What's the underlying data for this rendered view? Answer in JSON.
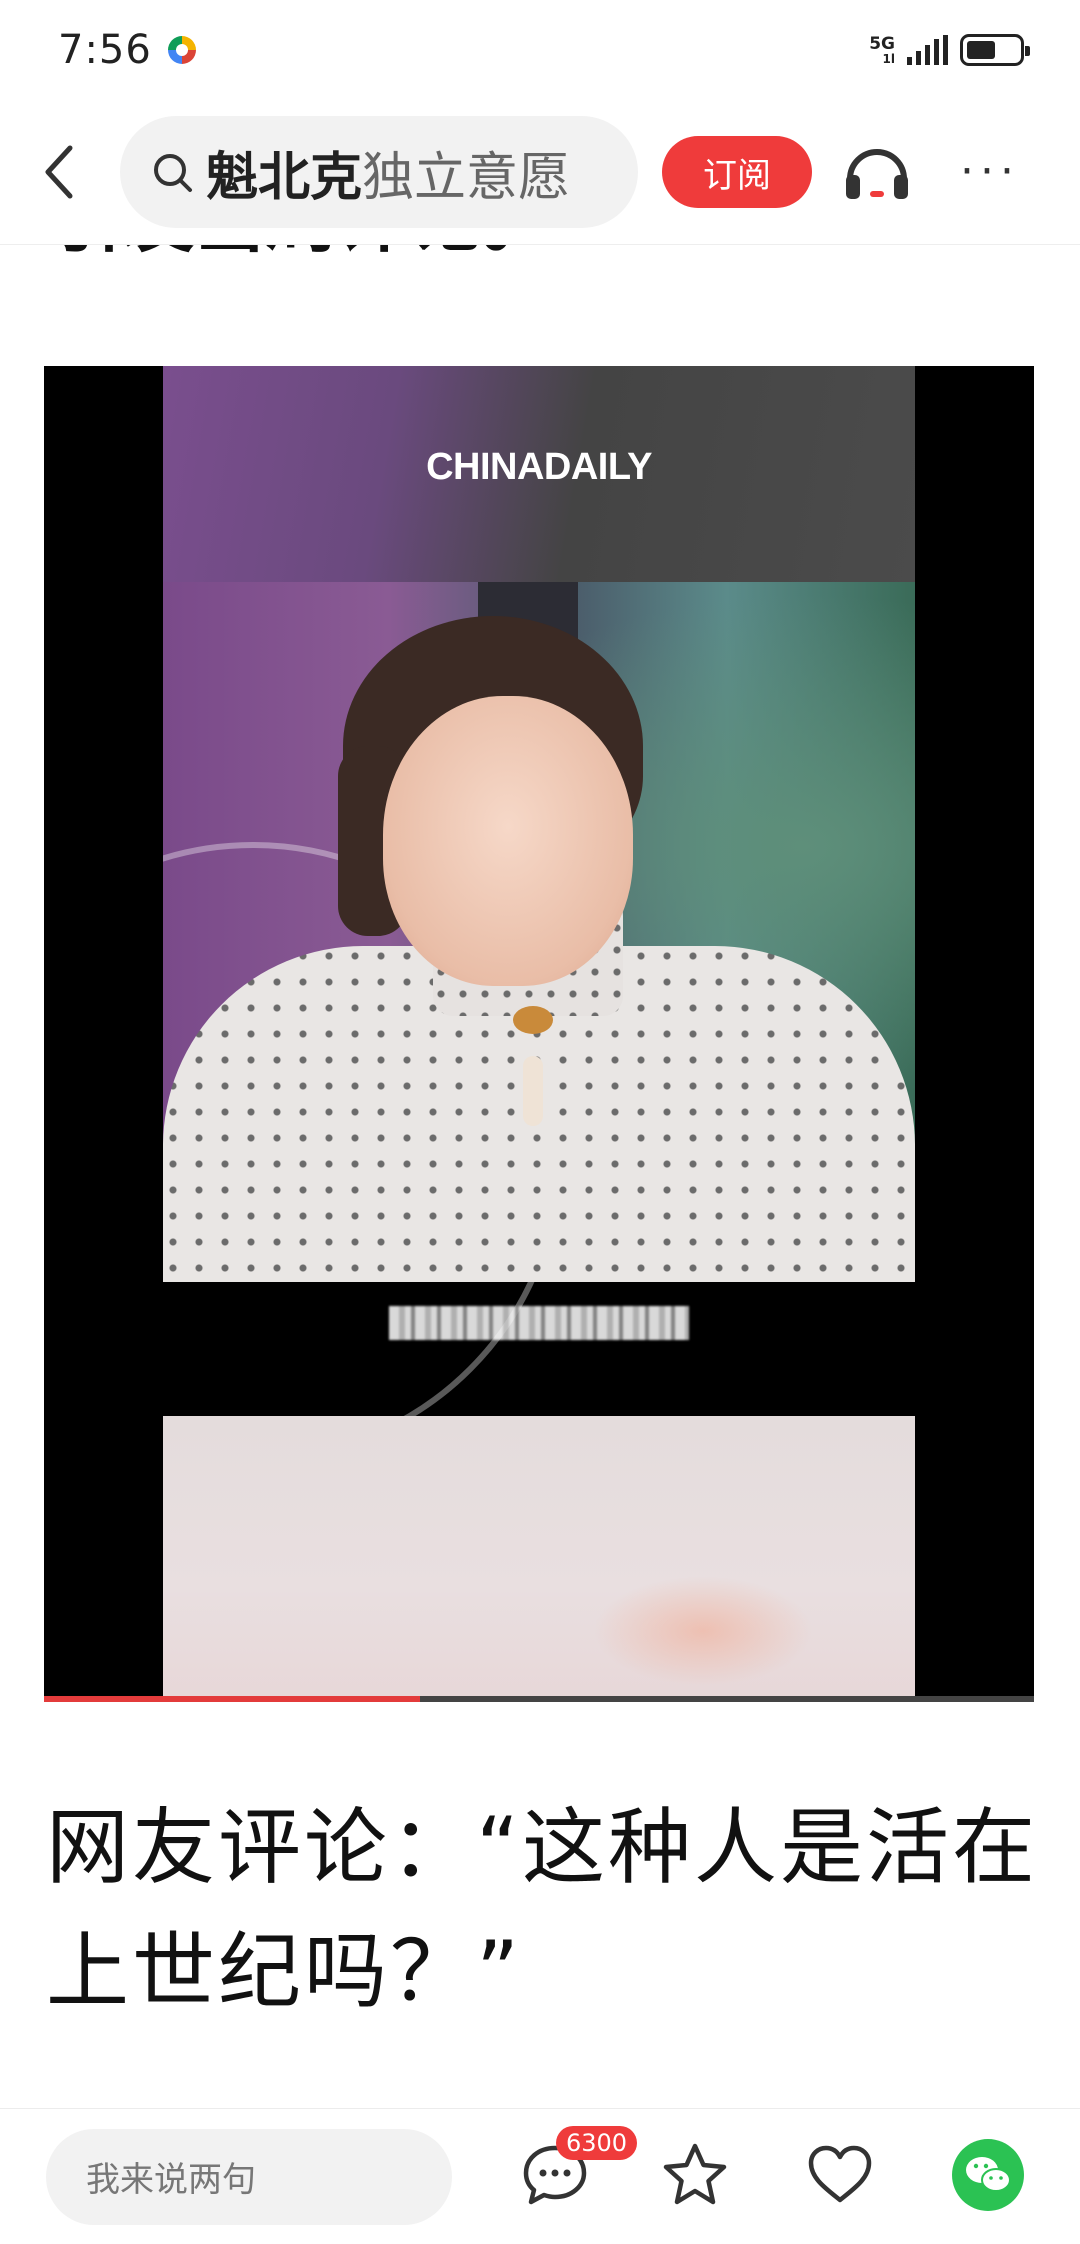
{
  "status_bar": {
    "time": "7:56",
    "network": "5G",
    "network_sub": "1l",
    "battery_level": 0.55
  },
  "nav": {
    "search_bold": "魁北克",
    "search_rest": "独立意愿",
    "subscribe_label": "订阅"
  },
  "article": {
    "partial_heading": "引发当局评论。",
    "video": {
      "logo": "CHINADAILY",
      "progress": 0.38
    },
    "caption": "网友评论：“这种人是活在上世纪吗？”"
  },
  "bottom_bar": {
    "comment_placeholder": "我来说两句",
    "comment_count": "6300"
  },
  "colors": {
    "accent": "#ef3b3b",
    "wechat": "#2bc253"
  },
  "icons": [
    "back-icon",
    "search-icon",
    "headphone-icon",
    "more-icon",
    "comment-icon",
    "star-icon",
    "heart-icon",
    "wechat-icon"
  ]
}
